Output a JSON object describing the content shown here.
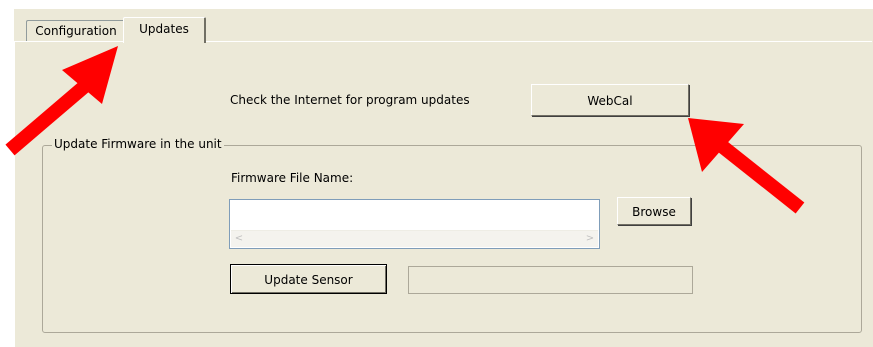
{
  "tabs": [
    {
      "label": "Configuration",
      "selected": false
    },
    {
      "label": "Updates",
      "selected": true
    }
  ],
  "updates": {
    "check_label": "Check the Internet for program updates",
    "webcal_label": "WebCal"
  },
  "firmware_group": {
    "title": "Update Firmware in the unit",
    "file_label": "Firmware File Name:",
    "file_value": "",
    "browse_label": "Browse",
    "update_label": "Update Sensor",
    "progress": 0
  },
  "annotations": {
    "arrow_color": "#ff0000"
  },
  "icons": {
    "scroll_left": "scroll-left-icon",
    "scroll_right": "scroll-right-icon"
  }
}
